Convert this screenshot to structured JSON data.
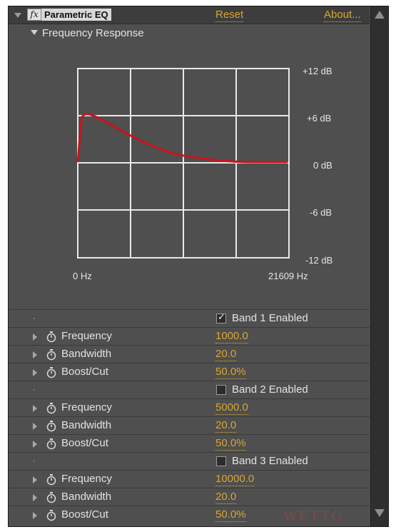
{
  "effect": {
    "name": "Parametric EQ",
    "fx_badge": "fx",
    "reset_label": "Reset",
    "about_label": "About..."
  },
  "frequency_response": {
    "label": "Frequency Response",
    "y_ticks": [
      "+12 dB",
      "+6 dB",
      "0 dB",
      "-6 dB",
      "-12 dB"
    ],
    "x_ticks": [
      "0 Hz",
      "21609 Hz"
    ],
    "curve_color": "#c8141c",
    "grid_color": "#e8e8e8"
  },
  "bands": [
    {
      "enabled_label": "Band 1 Enabled",
      "enabled": true,
      "params": [
        {
          "label": "Frequency",
          "value": "1000.0"
        },
        {
          "label": "Bandwidth",
          "value": "20.0"
        },
        {
          "label": "Boost/Cut",
          "value": "50.0%"
        }
      ]
    },
    {
      "enabled_label": "Band 2 Enabled",
      "enabled": false,
      "params": [
        {
          "label": "Frequency",
          "value": "5000.0"
        },
        {
          "label": "Bandwidth",
          "value": "20.0"
        },
        {
          "label": "Boost/Cut",
          "value": "50.0%"
        }
      ]
    },
    {
      "enabled_label": "Band 3 Enabled",
      "enabled": false,
      "params": [
        {
          "label": "Frequency",
          "value": "10000.0"
        },
        {
          "label": "Bandwidth",
          "value": "20.0"
        },
        {
          "label": "Boost/Cut",
          "value": "50.0%"
        }
      ]
    }
  ],
  "colors": {
    "panel_bg": "#4f4f4f",
    "value_accent": "#d9a531",
    "text": "#e2e2e2"
  },
  "watermark": "WETTG"
}
